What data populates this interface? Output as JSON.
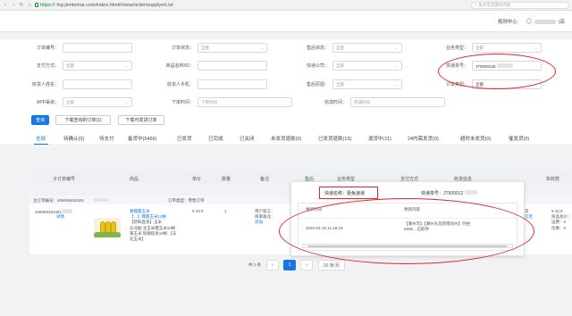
{
  "browser": {
    "scheme": "https://",
    "url": "fxg.jinritemai.com/index.html#/view/order/supplyerList",
    "search_placeholder": "张文宏说哪块肉能"
  },
  "header": {
    "help": "规则中心",
    "user_suffix": "|店"
  },
  "filters": {
    "order_no": "订单编号：",
    "order_status": "订单状态：",
    "order_status_value": "全部",
    "aftersale_status": "售后状态：",
    "aftersale_status_value": "全部",
    "biz_type": "业务类型：",
    "biz_type_value": "全部",
    "pay_method": "支付方式：",
    "pay_method_value": "全部",
    "product_id": "商品名称/ID：",
    "express_company": "快递公司：",
    "express_company_value": "全部",
    "tracking_no": "快递单号：",
    "tracking_no_value": "JT5000125",
    "receiver_name": "收货人姓名：",
    "receiver_phone": "收货人手机：",
    "aftersale_reason": "售后原因：",
    "aftersale_reason_value": "全部",
    "order_type": "订单类型：",
    "order_type_value": "全部",
    "app_channel": "APP渠道：",
    "app_channel_value": "全部",
    "order_time": "下单时间：",
    "order_time_placeholder": "下单时间",
    "finish_time": "完成时间：",
    "finish_time_placeholder": "完成时间"
  },
  "buttons": {
    "query": "查询",
    "download_pending": "下载查询的订单(1)",
    "download_unshipped": "下载可发货订单"
  },
  "tabs": [
    "全部",
    "待确认(0)",
    "待支付",
    "备货中(5466)",
    "已发货",
    "已完成",
    "已关闭",
    "未发货退款(0)",
    "已发货退款(13)",
    "退货中(11)",
    "24内需发货(0)",
    "超时未发货(0)",
    "催发货(0)"
  ],
  "table": {
    "headers": [
      "子订单编号",
      "商品",
      "单价",
      "数量",
      "备注",
      "售后",
      "业务类型",
      "支付方式",
      "收货信息",
      "实收款"
    ],
    "order_header": {
      "main_order": "主订单编号：465069453491",
      "order_type": "订单类型：零售订单"
    },
    "row": {
      "sub_order": "465069453491",
      "detail": "详情",
      "product_title": "春糯甜玉米",
      "product_line2": "【…】糯甜玉米10根",
      "product_line3": "【新鲜直发】玉米",
      "product_line4": "东北黏 北玉米糯玉米10根",
      "product_line5": "黄玉米 现摘现发10根 【东",
      "product_line6": "北玉米】",
      "price": "¥ 43.9",
      "qty": "1",
      "remark_line1": "用户留言：",
      "remark_line2": "商家备注：",
      "remark_add": "添加",
      "status": "已发货",
      "logistics": "物流信息",
      "pay_line1": "¥ 43.9",
      "pay_line2": "商品总价：",
      "pay_line3": "运费：0",
      "pay_line4": "优惠：0"
    }
  },
  "pagination": {
    "total": "共 1 条",
    "prev": "‹",
    "current": "1",
    "next": "›",
    "page_size": "20 条/页"
  },
  "popup": {
    "express_label": "快递名称：极兔速递",
    "tracking_label": "快递单号：JT500012",
    "col_time": "更新时间",
    "col_content": "更新内容",
    "log_time": "2020-04-18 11:19:18",
    "log_content_line1": "【潮州市】【潮州东昌府南同州】的柱",
    "log_content_line2": "6606…已取件"
  },
  "icons": {
    "back": "back-arrow-icon",
    "forward": "forward-arrow-icon",
    "refresh": "refresh-icon",
    "home": "home-icon",
    "lock": "lock-icon",
    "search": "search-icon",
    "user": "user-icon",
    "dropdown": "chevron-down-icon"
  },
  "colors": {
    "primary": "#1677e5",
    "annotation": "#e0262a"
  }
}
